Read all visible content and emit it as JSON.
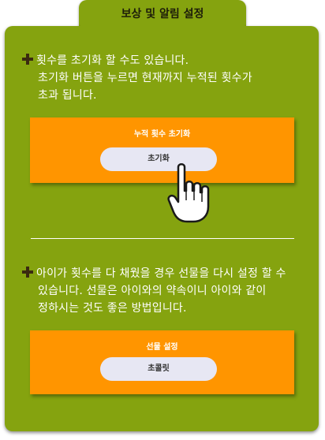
{
  "header": {
    "title": "보상 및 알림 설정"
  },
  "reset_section": {
    "lines": [
      "횟수를 초기화 할 수도 있습니다.",
      "초기화 버튼을 누르면 현재까지 누적된 횟수가",
      "초과 됩니다."
    ],
    "card_title": "누적 횟수 초기화",
    "button_label": "초기화"
  },
  "gift_section": {
    "lines": [
      "아이가 횟수를 다 채웠을 경우 선물을 다시 설정 할 수",
      "있습니다. 선물은 아이와의 약속이니 아이와 같이",
      "정하시는 것도 좋은 방법입니다."
    ],
    "card_title": "선물 설정",
    "button_label": "초콜릿"
  },
  "colors": {
    "panel": "#85a30f",
    "card": "#ff9500",
    "button": "#e7e7f3"
  },
  "icons": [
    "plus-icon",
    "pointer-hand-icon"
  ]
}
